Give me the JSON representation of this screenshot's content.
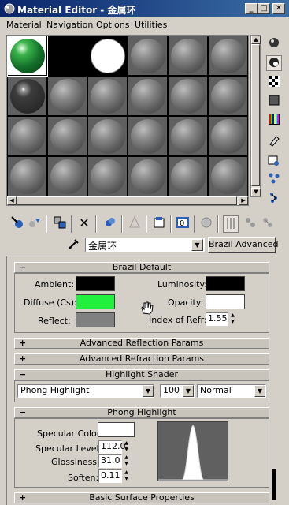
{
  "window": {
    "title": "Material Editor - 金属环",
    "minimize": "_",
    "maximize": "□",
    "close": "✕"
  },
  "menu": [
    "Material",
    "Navigation",
    "Options",
    "Utilities"
  ],
  "material": {
    "name": "金属环",
    "type_button": "Brazil Advanced"
  },
  "rollouts": {
    "brazil_default": {
      "title": "Brazil Default",
      "toggle": "−",
      "ambient_label": "Ambient:",
      "diffuse_label": "Diffuse (Cs):",
      "reflect_label": "Reflect:",
      "luminosity_label": "Luminosity:",
      "opacity_label": "Opacity:",
      "ior_label": "Index of Refr:",
      "ior_value": "1.55",
      "colors": {
        "ambient": "#000000",
        "diffuse": "#22f03f",
        "reflect": "#808080",
        "luminosity": "#000000",
        "opacity": "#ffffff"
      }
    },
    "adv_reflection": {
      "title": "Advanced Reflection Params",
      "toggle": "+"
    },
    "adv_refraction": {
      "title": "Advanced Refraction Params",
      "toggle": "+"
    },
    "highlight_shader": {
      "title": "Highlight Shader",
      "toggle": "−",
      "shader": "Phong Highlight",
      "amount": "100",
      "mode": "Normal"
    },
    "phong_highlight": {
      "title": "Phong Highlight",
      "toggle": "−",
      "specular_color_label": "Specular Color:",
      "specular_level_label": "Specular Level:",
      "specular_level": "112.0",
      "glossiness_label": "Glossiness:",
      "glossiness": "31.0",
      "soften_label": "Soften:",
      "soften": "0.11",
      "specular_color": "#ffffff"
    },
    "basic_surface": {
      "title": "Basic Surface Properties",
      "toggle": "+"
    }
  },
  "icons": {
    "right_toolbar": [
      "sample-type-sphere-icon",
      "backlight-icon",
      "background-checker-icon",
      "sample-uv-tiling-icon",
      "video-color-check-icon",
      "make-preview-icon",
      "options-icon",
      "select-by-material-icon",
      "material-map-navigator-icon"
    ],
    "bottom_toolbar": [
      "get-material-icon",
      "put-to-scene-icon",
      "assign-to-selection-icon",
      "reset-map-icon",
      "make-unique-icon",
      "put-to-library-icon",
      "material-effects-channel-icon",
      "show-map-in-viewport-icon",
      "show-end-result-icon",
      "go-to-parent-icon",
      "go-forward-to-sibling-icon"
    ]
  }
}
